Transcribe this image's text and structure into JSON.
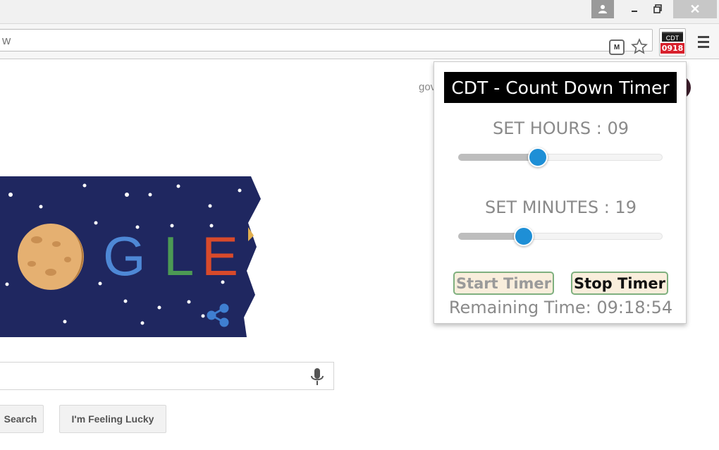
{
  "browser": {
    "omnibox_text": "w",
    "extension_badge": "0918",
    "extension_label": "CDT",
    "close_glyph": "✕"
  },
  "page": {
    "header_text": "gov",
    "search_button": "Search",
    "lucky_button": "I'm Feeling Lucky"
  },
  "popup": {
    "title": "CDT - Count Down Timer",
    "hours_label": "SET HOURS : 09",
    "hours_value": 9,
    "minutes_label": "SET MINUTES : 19",
    "minutes_value": 19,
    "start_button": "Start Timer",
    "stop_button": "Stop Timer",
    "remaining_text": "Remaining Time: 09:18:54"
  },
  "colors": {
    "slider_thumb": "#1e8fd6",
    "doodle_background": "#1f2760",
    "title_background": "#000000",
    "badge_red": "#d8202c"
  }
}
